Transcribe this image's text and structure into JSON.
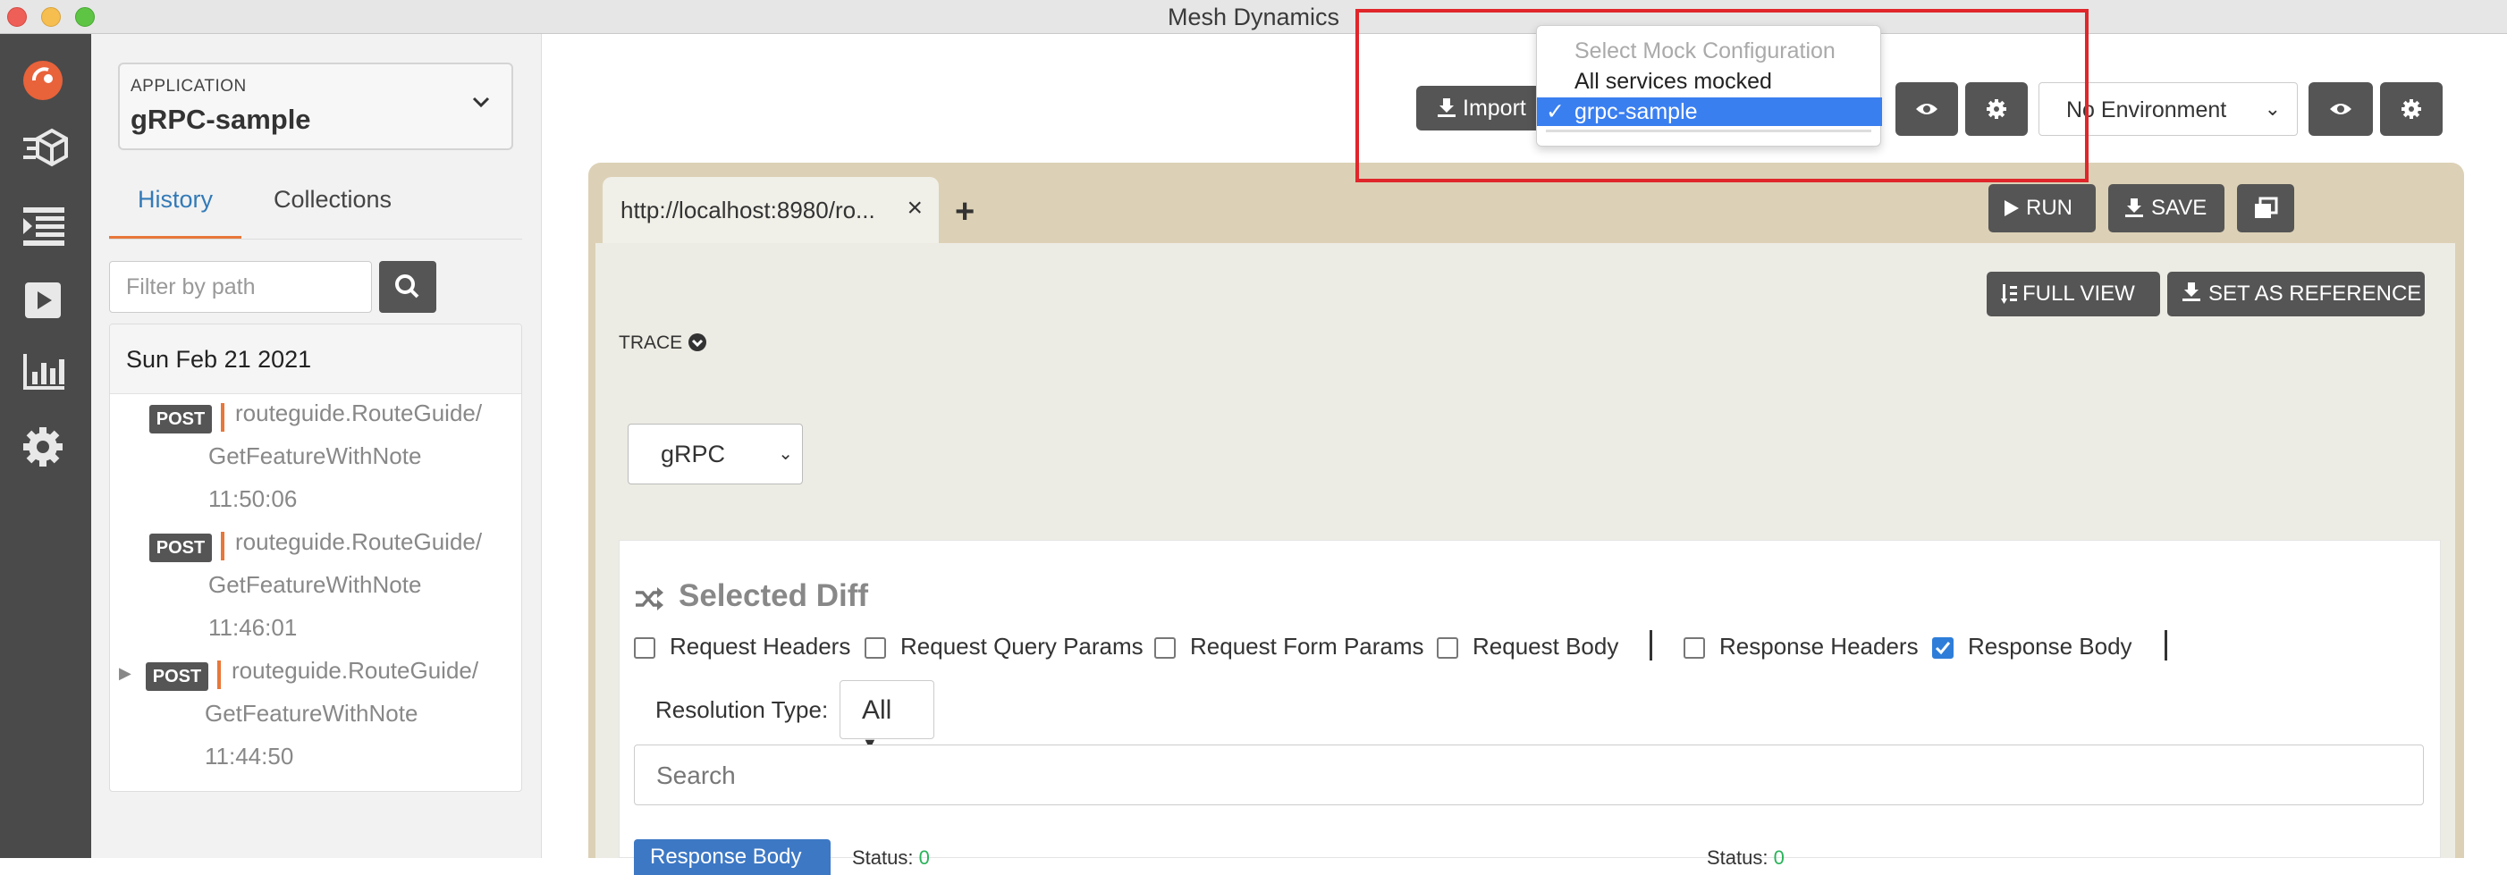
{
  "window": {
    "title": "Mesh Dynamics"
  },
  "sidebar": {
    "application_label": "APPLICATION",
    "application_value": "gRPC-sample",
    "tabs": [
      "History",
      "Collections"
    ],
    "filter_placeholder": "Filter by path",
    "history": {
      "date": "Sun Feb 21 2021",
      "items": [
        {
          "method": "POST",
          "path_line1": "routeguide.RouteGuide/",
          "path_line2": "GetFeatureWithNote",
          "time": "11:50:06"
        },
        {
          "method": "POST",
          "path_line1": "routeguide.RouteGuide/",
          "path_line2": "GetFeatureWithNote",
          "time": "11:46:01"
        },
        {
          "method": "POST",
          "path_line1": "routeguide.RouteGuide/",
          "path_line2": "GetFeatureWithNote",
          "time": "11:44:50"
        }
      ]
    }
  },
  "toolbar": {
    "import_label": "Import",
    "mock_config": {
      "placeholder": "Select Mock Configuration",
      "options": [
        "All services mocked",
        "grpc-sample"
      ],
      "selected": "grpc-sample"
    },
    "environment_value": "No Environment"
  },
  "request_tab": {
    "url": "http://localhost:8980/ro...",
    "close_glyph": "×",
    "add_glyph": "+"
  },
  "actions": {
    "run_label": "RUN",
    "save_label": "SAVE",
    "full_view_label": "FULL VIEW",
    "set_reference_label": "SET AS REFERENCE"
  },
  "trace_label": "TRACE",
  "protocol_value": "gRPC",
  "diff": {
    "title": "Selected Diff",
    "filters": [
      {
        "label": "Request Headers",
        "checked": false
      },
      {
        "label": "Request Query Params",
        "checked": false
      },
      {
        "label": "Request Form Params",
        "checked": false
      },
      {
        "label": "Request Body",
        "checked": false
      },
      {
        "label": "Response Headers",
        "checked": false
      },
      {
        "label": "Response Body",
        "checked": true
      }
    ],
    "resolution_label": "Resolution Type:",
    "resolution_value": "All",
    "search_placeholder": "Search",
    "response_body_chip": "Response Body",
    "status_left_label": "Status:",
    "status_left_value": "0",
    "status_right_label": "Status:",
    "status_right_value": "0"
  },
  "colors": {
    "accent_orange": "#e8773a",
    "link_blue": "#337ab7",
    "highlight_red": "#e0262b",
    "selected_option_blue": "#3a7ff0",
    "rail_bg": "#4a4a4a",
    "tab_strip_bg": "#dcd1b6"
  }
}
